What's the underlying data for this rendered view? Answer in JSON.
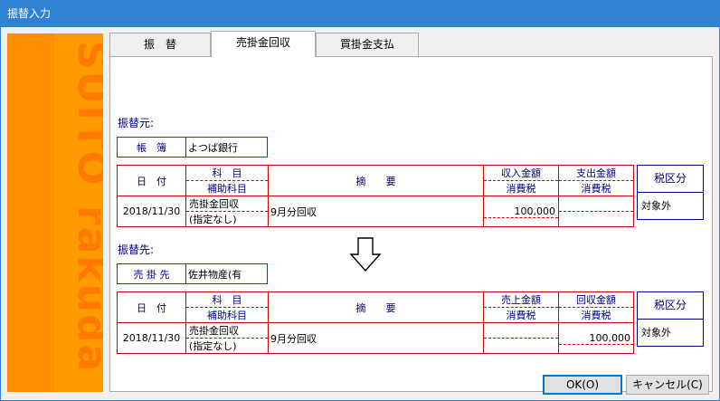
{
  "window": {
    "title": "振替入力"
  },
  "sidebar": {
    "brand_top": "SUITO",
    "brand_bottom": "rakuda"
  },
  "tabs": [
    {
      "label": "振　替"
    },
    {
      "label": "売掛金回収"
    },
    {
      "label": "買掛金支払"
    }
  ],
  "source": {
    "heading": "振替元:",
    "account_label": "帳　簿",
    "account_value": "よつば銀行",
    "headers": {
      "date": "日　付",
      "subject": "科　目",
      "sub_subject": "補助科目",
      "summary": "摘　　要",
      "col4_top": "収入金額",
      "col4_bottom": "消費税",
      "col5_top": "支出金額",
      "col5_bottom": "消費税",
      "tax": "税区分"
    },
    "row": {
      "date": "2018/11/30",
      "subject": "売掛金回収",
      "sub_subject": "(指定なし)",
      "summary": "9月分回収",
      "col4_amount": "100,000",
      "col4_tax": "",
      "col5_amount": "",
      "col5_tax": "",
      "tax": "対象外"
    }
  },
  "destination": {
    "heading": "振替先:",
    "account_label": "売 掛 先",
    "account_value": "佐井物産(有",
    "headers": {
      "date": "日　付",
      "subject": "科　目",
      "sub_subject": "補助科目",
      "summary": "摘　　要",
      "col4_top": "売上金額",
      "col4_bottom": "消費税",
      "col5_top": "回収金額",
      "col5_bottom": "消費税",
      "tax": "税区分"
    },
    "row": {
      "date": "2018/11/30",
      "subject": "売掛金回収",
      "sub_subject": "(指定なし)",
      "summary": "9月分回収",
      "col4_amount": "",
      "col4_tax": "",
      "col5_amount": "100,000",
      "col5_tax": "",
      "tax": "対象外"
    }
  },
  "buttons": {
    "ok": "OK(O)",
    "cancel": "キャンセル(C)"
  },
  "colors": {
    "titlebar": "#2f82d4",
    "sidebar": "#ff9b00",
    "grid_border": "#d00000",
    "header_text": "#000080"
  }
}
